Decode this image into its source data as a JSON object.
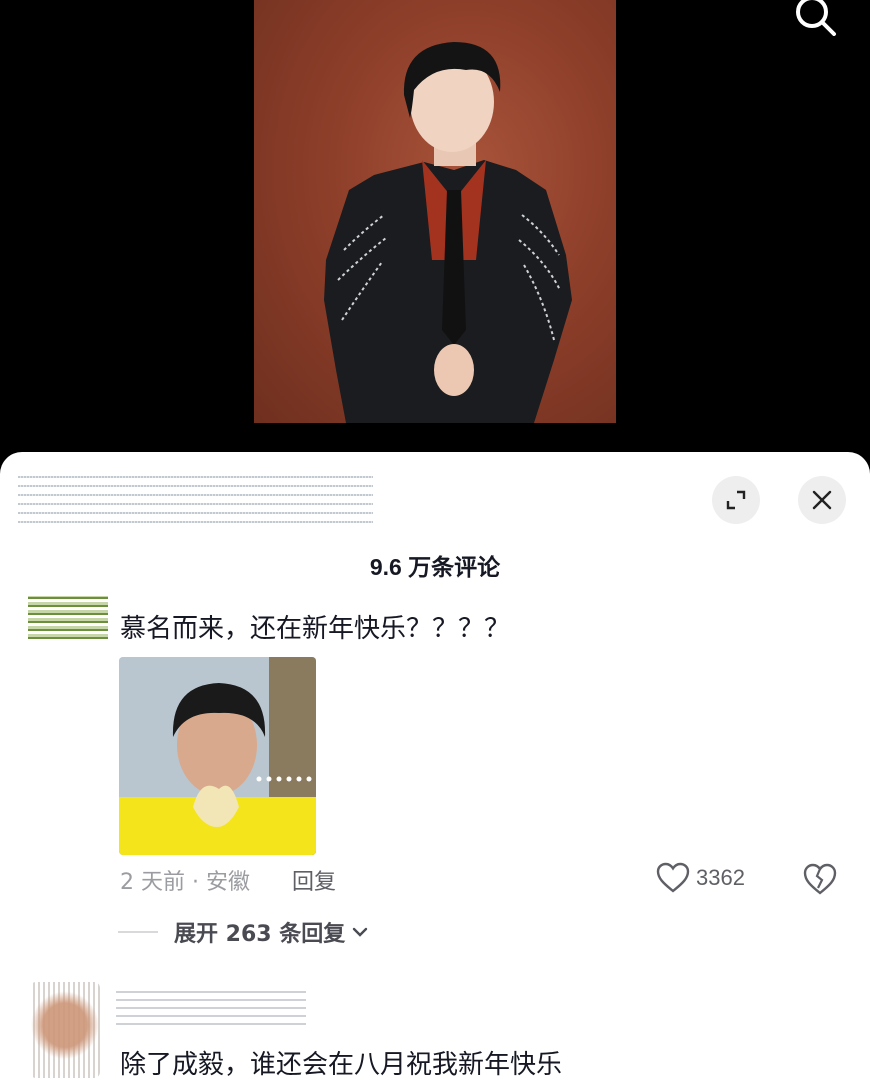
{
  "comments_panel": {
    "count_label": "9.6 万条评论"
  },
  "comments": [
    {
      "text": "慕名而来，还在新年快乐？？？？",
      "time": "2 天前",
      "separator": "·",
      "location": "安徽",
      "reply_label": "回复",
      "likes": "3362",
      "expand_label": "展开 263 条回复"
    },
    {
      "text": "除了成毅，谁还会在八月祝我新年快乐"
    }
  ],
  "icons": {
    "search": "search-icon",
    "expand": "expand-icon",
    "close": "close-icon",
    "like": "heart-icon",
    "dislike": "broken-heart-icon",
    "chevron": "chevron-down-icon"
  }
}
